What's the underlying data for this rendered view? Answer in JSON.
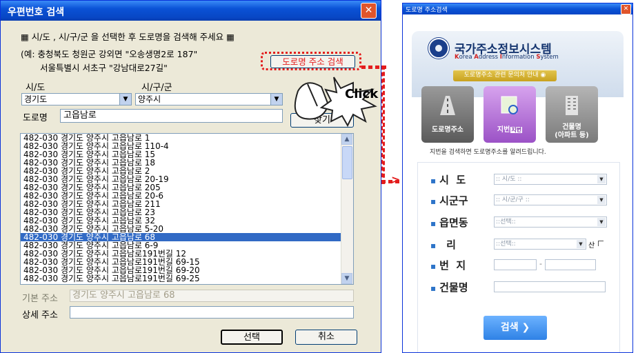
{
  "left_window": {
    "title": "우편번호 검색",
    "close_glyph": "✕",
    "instruction": "▦ 시/도 , 시/구/군 을 선택한 후 도로명을 검색해 주세요 ▦",
    "example_line1": "(예: 충청북도 청원군 강외면 \"오송생명2로 187\"",
    "example_line2": "서울특별시 서초구 \"강남대로27길\"",
    "road_search_button": "도로명 주소 검색",
    "sido_label": "시/도",
    "sigungu_label": "시/구/군",
    "sido_value": "경기도",
    "sigungu_value": "양주시",
    "road_label": "도로명",
    "road_value": "고읍남로",
    "find_button": "찾기",
    "results": [
      "482-030 경기도 양주시 고읍남로 1",
      "482-030 경기도 양주시 고읍남로 110-4",
      "482-030 경기도 양주시 고읍남로 15",
      "482-030 경기도 양주시 고읍남로 18",
      "482-030 경기도 양주시 고읍남로 2",
      "482-030 경기도 양주시 고읍남로 20-19",
      "482-030 경기도 양주시 고읍남로 205",
      "482-030 경기도 양주시 고읍남로 20-6",
      "482-030 경기도 양주시 고읍남로 211",
      "482-030 경기도 양주시 고읍남로 23",
      "482-030 경기도 양주시 고읍남로 32",
      "482-030 경기도 양주시 고읍남로 5-20",
      "482-030 경기도 양주시 고읍남로 68",
      "482-030 경기도 양주시 고읍남로 6-9",
      "482-030 경기도 양주시 고읍남로191번길 12",
      "482-030 경기도 양주시 고읍남로191번길 69-15",
      "482-030 경기도 양주시 고읍남로191번길 69-20",
      "482-030 경기도 양주시 고읍남로191번길 69-25"
    ],
    "selected_index": 12,
    "basic_address_label": "기본 주소",
    "basic_address_value": "경기도 양주시 고읍남로 68",
    "detail_address_label": "상세 주소",
    "detail_address_value": "",
    "select_button": "선택",
    "cancel_button": "취소",
    "click_callout": "Click"
  },
  "right_window": {
    "title": "도로명 주소검색",
    "close_glyph": "✕",
    "brand_title": "국가주소정보시스템",
    "brand_subtitle": [
      {
        "cap": "K",
        "rest": "orea "
      },
      {
        "cap": "A",
        "rest": "ddress "
      },
      {
        "cap": "I",
        "rest": "nformation "
      },
      {
        "cap": "S",
        "rest": "ystem"
      }
    ],
    "inquiry_button": "도로명주소 관련 문의처 안내",
    "tiles": [
      {
        "label": "도로명주소",
        "color": "#6b6b6b"
      },
      {
        "label": "지번",
        "badge": "지번",
        "color": "#b06fd3"
      },
      {
        "label": "건물명\n(아파트 등)",
        "color": "#8a8a8a"
      }
    ],
    "note": "지번을 검색하면 도로명주소를 알려드립니다.",
    "form": {
      "sido_label": "시  도",
      "sido_value": ":: 시/도 ::",
      "sigungu_label": "시군구",
      "sigungu_value": ":: 시/군/구 ::",
      "eupmyeondong_label": "읍면동",
      "eupmyeondong_value": "::선택::",
      "ri_label": "리",
      "ri_value": "::선택::",
      "san_label": "산",
      "bunji_label": "번  지",
      "bunji_separator": "-",
      "building_label": "건물명"
    },
    "search_button": "검색 ❯"
  }
}
